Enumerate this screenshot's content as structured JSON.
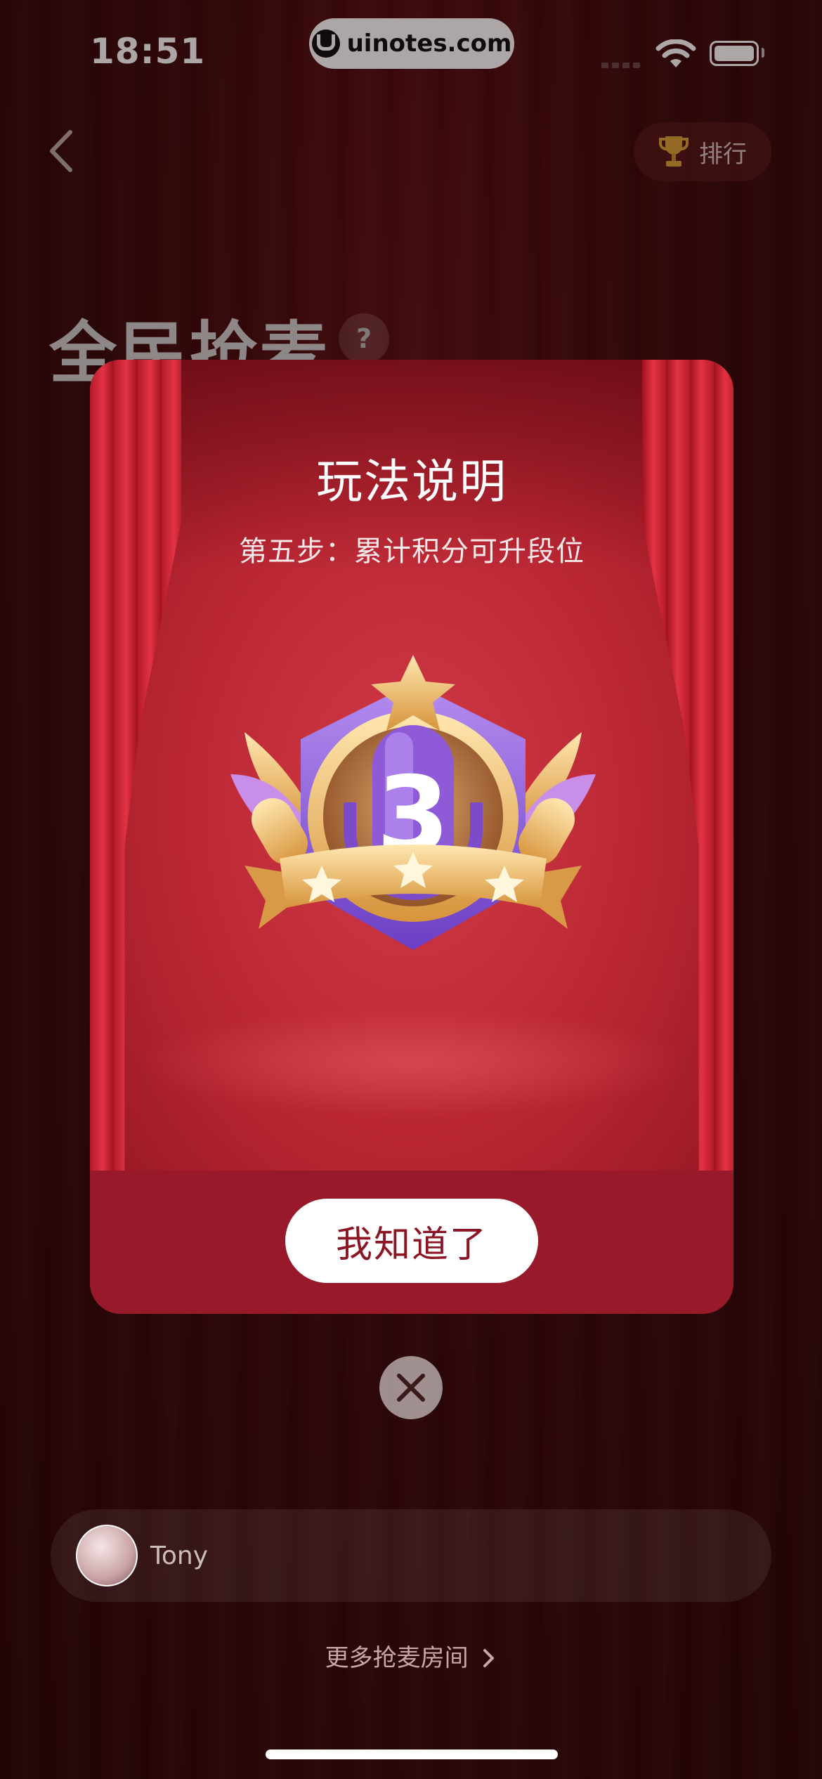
{
  "status_bar": {
    "time": "18:51",
    "url": "uinotes.com"
  },
  "header": {
    "rank_label": "排行",
    "page_title": "全民抢麦",
    "help_label": "?"
  },
  "modal": {
    "title": "玩法说明",
    "subtitle": "第五步：累计积分可升段位",
    "badge_number": "3",
    "confirm_label": "我知道了"
  },
  "user": {
    "name": "Tony"
  },
  "footer": {
    "more_rooms_label": "更多抢麦房间"
  },
  "colors": {
    "accent": "#9a1d29",
    "stage": "#c42c3a",
    "button_text": "#8c1524"
  }
}
